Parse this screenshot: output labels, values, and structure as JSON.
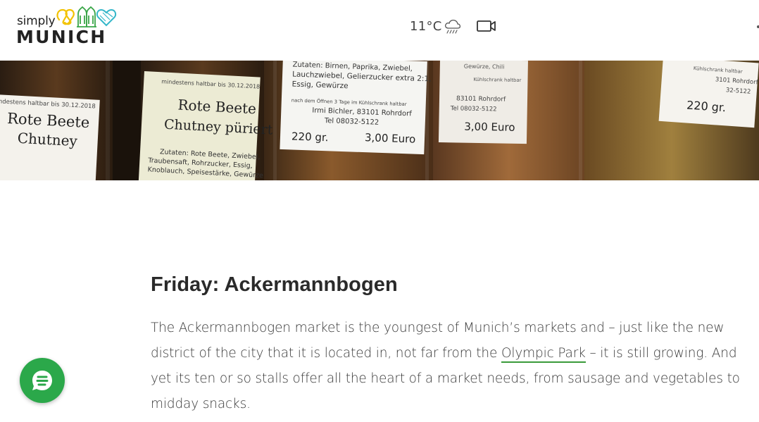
{
  "header": {
    "logo": {
      "small_text": "simply",
      "big_text": "MUNICH"
    },
    "weather": {
      "temperature": "11°C",
      "icon": "rain-cloud-icon"
    },
    "video_icon": "video-camera-icon"
  },
  "hero": {
    "jar_labels": [
      {
        "lines": [
          "indestens haltbar bis 30.12.2018",
          "Rote Beete",
          "Chutney"
        ]
      },
      {
        "lines": [
          "mindestens haltbar bis 30.12.2018",
          "Rote Beete",
          "Chutney püriert",
          "Zutaten: Rote Beete, Zwiebel,",
          "Traubensaft, Rohrzucker, Essig,",
          "Knoblauch, Speisestärke, Gewürze"
        ]
      },
      {
        "lines": [
          "Zutaten: Birnen, Paprika, Zwiebel,",
          "Lauchzwiebel, Gelierzucker extra 2:1,",
          "Essig, Gewürze",
          "nach dem Öffnen 3 Tage im Kühlschrank haltbar",
          "Irmi Bichler, 83101 Rohrdorf",
          "Tel 08032-5122",
          "220 gr.",
          "3,00 Euro"
        ]
      },
      {
        "lines": [
          "Gewürze, Chili",
          "Kühlschrank haltbar",
          "83101 Rohrdorf",
          "Tel 08032-5122",
          "3,00 Euro"
        ]
      },
      {
        "lines": [
          "Kühlschrank haltbar",
          "3101 Rohrdorf",
          "32-5122",
          "220 gr."
        ]
      }
    ]
  },
  "article": {
    "title": "Friday: Ackermannbogen",
    "body_before": "The Ackermannbogen market is the youngest of Munich’s markets and – just like the new district of the city that it is located in, not far from the ",
    "link_text": "Olympic Park",
    "body_after": " – it is still growing. And yet its ten or so stalls offer all the heart of a market needs, from sausage and vegetables to midday snacks."
  },
  "chat": {
    "icon": "chat-bubble-icon"
  },
  "colors": {
    "accent_green": "#2ba84a",
    "link_underline": "#3a9a3a",
    "logo_yellow": "#f2c200",
    "logo_teal": "#35b7c9"
  }
}
